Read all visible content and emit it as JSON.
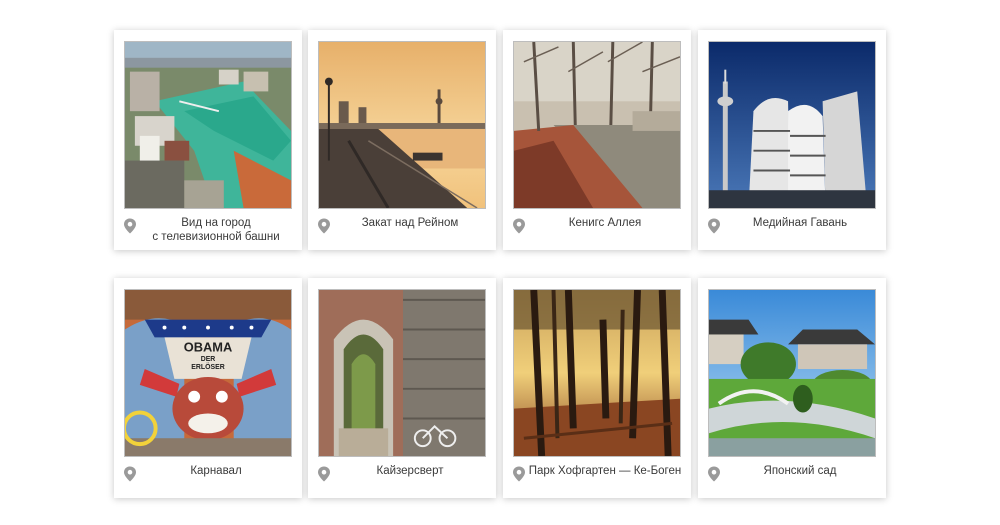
{
  "gallery": {
    "items": [
      {
        "caption": "Вид на город\nс телевизионной башни",
        "icon": "location-pin-icon"
      },
      {
        "caption": "Закат над Рейном",
        "icon": "location-pin-icon"
      },
      {
        "caption": "Кенигс Аллея",
        "icon": "location-pin-icon"
      },
      {
        "caption": "Медийная Гавань",
        "icon": "location-pin-icon"
      },
      {
        "caption": "Карнавал",
        "icon": "location-pin-icon"
      },
      {
        "caption": "Кайзерсверт",
        "icon": "location-pin-icon"
      },
      {
        "caption": "Парк Хофгартен — Ке-Боген",
        "icon": "location-pin-icon"
      },
      {
        "caption": "Японский сад",
        "icon": "location-pin-icon"
      }
    ],
    "photo_text": {
      "sign_line1": "OBAMA",
      "sign_line2": "DER",
      "sign_line3": "ERLÖSER"
    }
  },
  "colors": {
    "caption_text": "#3a3a3a",
    "pin": "#9a9a9a",
    "card_bg": "#ffffff"
  }
}
